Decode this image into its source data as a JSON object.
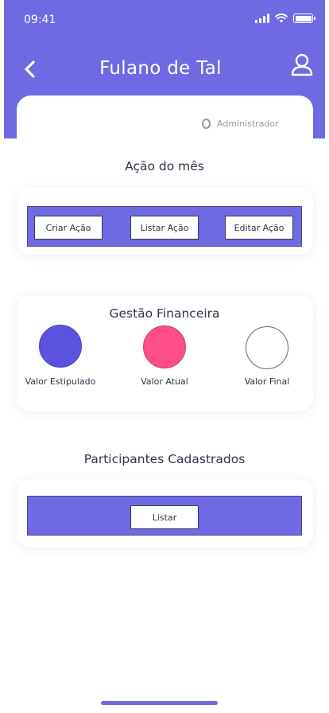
{
  "status_bar": {
    "time": "09:41"
  },
  "header": {
    "title": "Fulano de Tal"
  },
  "user": {
    "role": "Administrador"
  },
  "acao": {
    "title": "Ação do mês",
    "buttons": {
      "create": "Criar Ação",
      "list": "Listar Ação",
      "edit": "Editar Ação"
    }
  },
  "financeiro": {
    "title": "Gestão Financeira",
    "items": [
      {
        "label": "Valor Estipulado",
        "color": "#5b52dd"
      },
      {
        "label": "Valor Atual",
        "color": "#ff4d8a"
      },
      {
        "label": "Valor Final",
        "color": "#ffffff"
      }
    ]
  },
  "participantes": {
    "title": "Participantes Cadastrados",
    "list_label": "Listar"
  },
  "colors": {
    "primary": "#6f6ae3",
    "accent_pink": "#ff4d8a",
    "accent_purple": "#5b52dd"
  }
}
